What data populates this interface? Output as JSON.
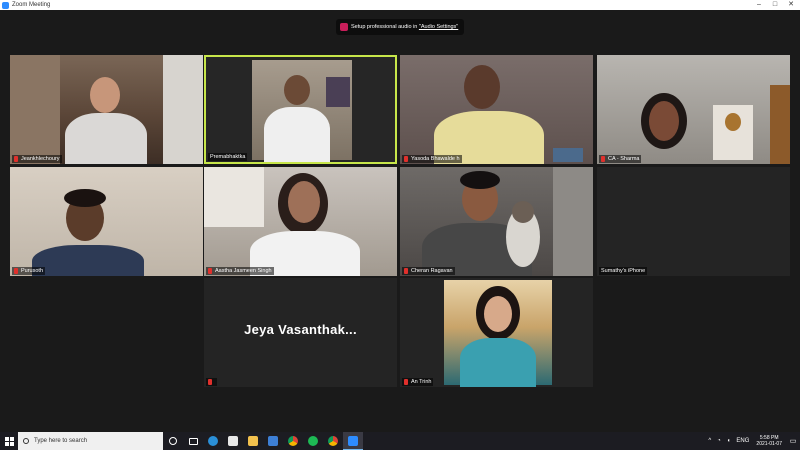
{
  "window": {
    "title": "Zoom Meeting",
    "controls": [
      "–",
      "□",
      "✕"
    ]
  },
  "banner": {
    "prefix": "Setup professional audio in ",
    "link": "\"Audio Settings\""
  },
  "participants": [
    {
      "name": "Jeankhlechoury",
      "muted": true
    },
    {
      "name": "Premabhaktka",
      "muted": false,
      "active_speaker": true
    },
    {
      "name": "Yasoda Bhawalde h",
      "muted": true
    },
    {
      "name": "CA - Sharma",
      "muted": true
    },
    {
      "name": "Purusoth",
      "muted": true
    },
    {
      "name": "Aastha Jasmeen Singh",
      "muted": true
    },
    {
      "name": "Cheran Ragavan",
      "muted": true
    },
    {
      "name": "Sumathy's iPhone",
      "muted": false,
      "video_off": true
    },
    {
      "name": "Jeya Vasanthak...",
      "muted": true,
      "video_off": true,
      "display": "Jeya  Vasanthak..."
    },
    {
      "name": "An Trinh",
      "muted": true
    }
  ],
  "taskbar": {
    "search_placeholder": "Type here to search",
    "language": "ENG",
    "time": "5:58 PM",
    "date": "2021-01-07"
  },
  "colors": {
    "active_speaker_border": "#c7e64a",
    "muted_icon": "#e0302c",
    "banner_chip": "#c81e5a"
  }
}
